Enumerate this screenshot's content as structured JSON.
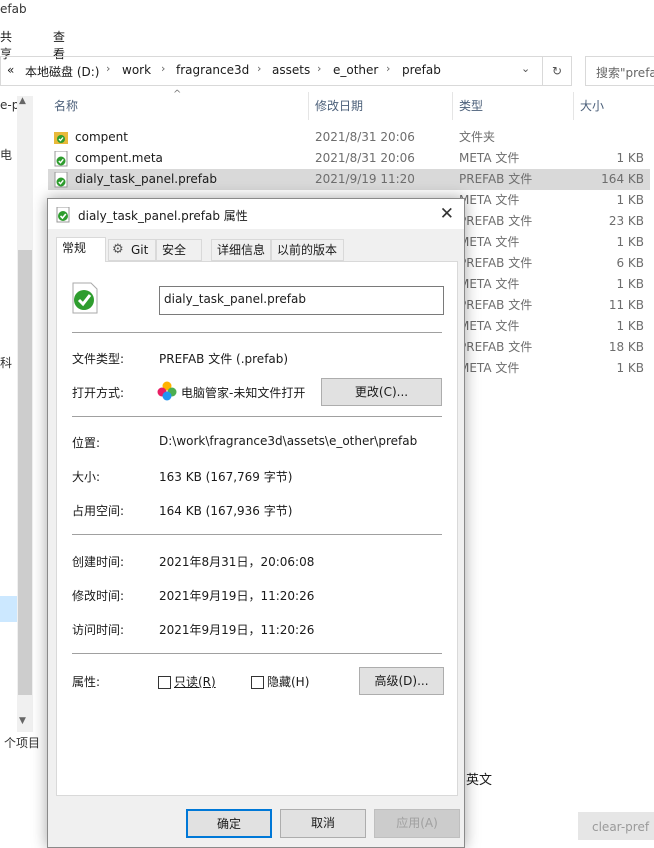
{
  "window": {
    "title_fragment": "efab"
  },
  "menubar": {
    "share": "共享",
    "view": "查看"
  },
  "address": {
    "back_chevron": "«",
    "crumbs": [
      "本地磁盘 (D:)",
      "work",
      "fragrance3d",
      "assets",
      "e_other",
      "prefab"
    ],
    "search_placeholder": "搜索\"prefab\""
  },
  "nav": {
    "frag1": "e-p",
    "frag2": "电",
    "frag3": "科"
  },
  "columns": {
    "name": "名称",
    "date": "修改日期",
    "type": "类型",
    "size": "大小"
  },
  "files": [
    {
      "name": "compent",
      "date": "2021/8/31 20:06",
      "type": "文件夹",
      "size": ""
    },
    {
      "name": "compent.meta",
      "date": "2021/8/31 20:06",
      "type": "META 文件",
      "size": "1 KB"
    },
    {
      "name": "dialy_task_panel.prefab",
      "date": "2021/9/19 11:20",
      "type": "PREFAB 文件",
      "size": "164 KB"
    },
    {
      "name": "",
      "date": "",
      "type": "META 文件",
      "size": "1 KB"
    },
    {
      "name": "",
      "date": "",
      "type": "PREFAB 文件",
      "size": "23 KB"
    },
    {
      "name": "",
      "date": "",
      "type": "META 文件",
      "size": "1 KB"
    },
    {
      "name": "",
      "date": "",
      "type": "PREFAB 文件",
      "size": "6 KB"
    },
    {
      "name": "",
      "date": "",
      "type": "META 文件",
      "size": "1 KB"
    },
    {
      "name": "",
      "date": "",
      "type": "PREFAB 文件",
      "size": "11 KB"
    },
    {
      "name": "",
      "date": "",
      "type": "META 文件",
      "size": "1 KB"
    },
    {
      "name": "",
      "date": "",
      "type": "PREFAB 文件",
      "size": "18 KB"
    },
    {
      "name": "",
      "date": "",
      "type": "META 文件",
      "size": "1 KB"
    }
  ],
  "status": {
    "count": "个项目"
  },
  "bottom": {
    "english": "英文",
    "clear_btn": "clear-pref"
  },
  "dialog": {
    "title": "dialy_task_panel.prefab 属性",
    "close": "✕",
    "tabs": {
      "general": "常规",
      "git": "Git",
      "security": "安全",
      "details": "详细信息",
      "previous": "以前的版本"
    },
    "filename": "dialy_task_panel.prefab",
    "labels": {
      "file_type": "文件类型:",
      "open_with": "打开方式:",
      "location": "位置:",
      "size": "大小:",
      "size_on_disk": "占用空间:",
      "created": "创建时间:",
      "modified": "修改时间:",
      "accessed": "访问时间:",
      "attributes": "属性:"
    },
    "values": {
      "file_type": "PREFAB 文件 (.prefab)",
      "open_with": "电脑管家-未知文件打开",
      "location": "D:\\work\\fragrance3d\\assets\\e_other\\prefab",
      "size": "163 KB (167,769 字节)",
      "size_on_disk": "164 KB (167,936 字节)",
      "created": "2021年8月31日，20:06:08",
      "modified": "2021年9月19日，11:20:26",
      "accessed": "2021年9月19日，11:20:26"
    },
    "buttons": {
      "change": "更改(C)...",
      "advanced": "高级(D)...",
      "ok": "确定",
      "cancel": "取消",
      "apply": "应用(A)"
    },
    "checkboxes": {
      "readonly": "只读(R)",
      "hidden": "隐藏(H)"
    }
  },
  "colors": {
    "accent": "#0078d7",
    "selected_row": "#d9d9d9",
    "icon_green": "#2e9d2e"
  }
}
